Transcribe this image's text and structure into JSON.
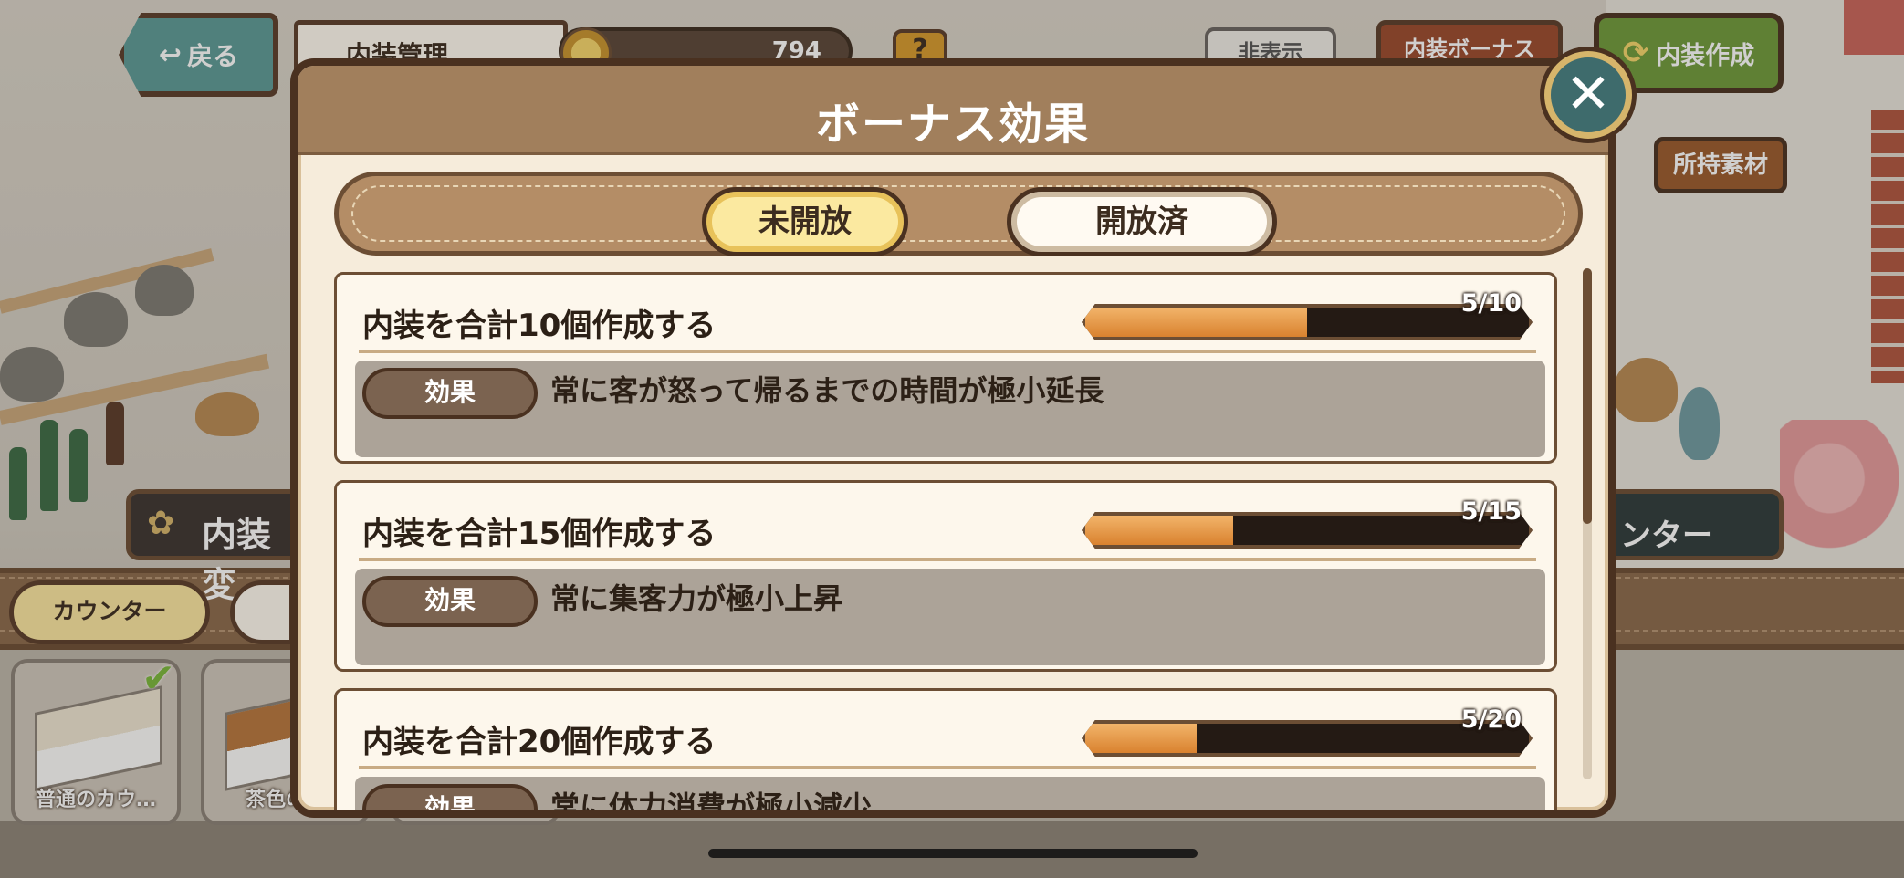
{
  "top_bar": {
    "back_label": "戻る",
    "back_icon": "↩",
    "screen_title": "内装管理",
    "coins": "794",
    "help_label": "?",
    "hide_label": "非表示",
    "bonus_label": "内装ボーナス",
    "craft_label": "内装作成",
    "craft_icon": "⟳",
    "materials_label": "所持素材"
  },
  "background": {
    "left_banner": "内装変",
    "right_banner": "ンター",
    "category_tab": "カウンター",
    "items": [
      {
        "name": "普通のカウ…",
        "checked": true
      },
      {
        "name": "茶色のカ",
        "checked": false
      }
    ]
  },
  "modal": {
    "title": "ボーナス効果",
    "close_icon": "✕",
    "tabs": [
      {
        "label": "未開放",
        "active": true
      },
      {
        "label": "開放済",
        "active": false
      }
    ],
    "effect_badge_label": "効果",
    "bonuses": [
      {
        "title": "内装を合計10個作成する",
        "progress_text": "5/10",
        "progress": 0.5,
        "effect": "常に客が怒って帰るまでの時間が極小延長"
      },
      {
        "title": "内装を合計15個作成する",
        "progress_text": "5/15",
        "progress": 0.3333,
        "effect": "常に集客力が極小上昇"
      },
      {
        "title": "内装を合計20個作成する",
        "progress_text": "5/20",
        "progress": 0.25,
        "effect": "常に体力消費が極小減少"
      }
    ]
  },
  "colors": {
    "header_brown": "#a17f5c",
    "active_tab": "#fbe9a0",
    "progress_fill": "#d9822f",
    "close_button": "#3e6b6c"
  }
}
